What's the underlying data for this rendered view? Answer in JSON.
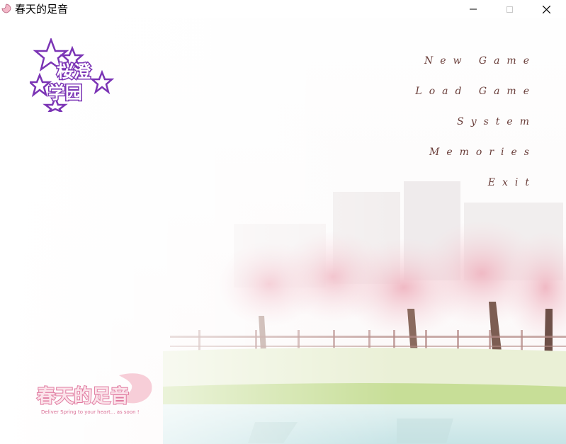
{
  "window": {
    "title": "春天的足音"
  },
  "menu": {
    "items": [
      {
        "label": "New Game"
      },
      {
        "label": "Load Game"
      },
      {
        "label": "System"
      },
      {
        "label": "Memories"
      },
      {
        "label": "Exit"
      }
    ]
  },
  "logos": {
    "school": {
      "text": "桜澄学园",
      "color": "#7b34b5"
    },
    "game": {
      "text": "春天的足音",
      "tagline": "Deliver Spring to your heart... as soon !",
      "color": "#e07aa0"
    }
  },
  "colors": {
    "menu_text": "#6a3e3a",
    "blossom": "#f4c6cf",
    "grass": "#b9d98a",
    "water": "#cfe9ea"
  },
  "icons": {
    "window_icon": "sakura-icon"
  }
}
